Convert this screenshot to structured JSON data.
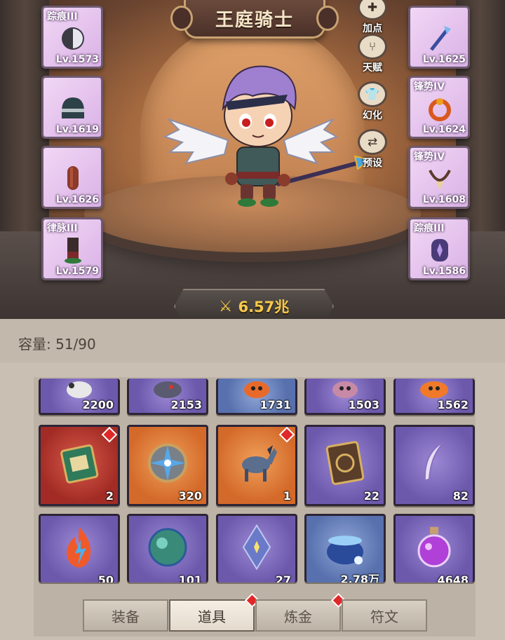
{
  "title": "王庭骑士",
  "left_slots": [
    {
      "name": "踪痕III",
      "level": "Lv.1573",
      "icon": "gloves-icon"
    },
    {
      "name": "",
      "level": "Lv.1619",
      "icon": "helmet-icon"
    },
    {
      "name": "",
      "level": "Lv.1626",
      "icon": "boots-icon"
    },
    {
      "name": "律脉III",
      "level": "Lv.1579",
      "icon": "leg-armor-icon"
    }
  ],
  "right_slots": [
    {
      "name": "",
      "level": "Lv.1625",
      "icon": "staff-icon"
    },
    {
      "name": "锋势IV",
      "level": "Lv.1624",
      "icon": "ring-icon"
    },
    {
      "name": "锋势IV",
      "level": "Lv.1608",
      "icon": "amulet-icon"
    },
    {
      "name": "踪痕III",
      "level": "Lv.1586",
      "icon": "charm-icon"
    }
  ],
  "side_menu": [
    {
      "label": "加点",
      "icon": "add-points-icon"
    },
    {
      "label": "天赋",
      "icon": "talent-tree-icon"
    },
    {
      "label": "幻化",
      "icon": "costume-icon"
    },
    {
      "label": "预设",
      "icon": "preset-icon"
    }
  ],
  "power": "6.57兆",
  "capacity_label": "容量: 51/90",
  "items_row1": [
    {
      "qty": "2200",
      "color": "purple",
      "icon": "pet-bird-icon"
    },
    {
      "qty": "2153",
      "color": "purple",
      "icon": "pet-beast-icon"
    },
    {
      "qty": "1731",
      "color": "blue",
      "icon": "pet-fox-icon"
    },
    {
      "qty": "1503",
      "color": "purple",
      "icon": "pet-pig-icon"
    },
    {
      "qty": "1562",
      "color": "purple",
      "icon": "pet-fox-orange-icon"
    }
  ],
  "items_row2": [
    {
      "qty": "2",
      "color": "red",
      "icon": "book-green-icon",
      "badge": true
    },
    {
      "qty": "320",
      "color": "orange",
      "icon": "compass-medal-icon",
      "badge": false
    },
    {
      "qty": "1",
      "color": "orange",
      "icon": "horse-icon",
      "badge": true
    },
    {
      "qty": "22",
      "color": "purple",
      "icon": "book-gold-icon",
      "badge": false
    },
    {
      "qty": "82",
      "color": "purple",
      "icon": "feather-quill-icon",
      "badge": false
    }
  ],
  "items_row3": [
    {
      "qty": "50",
      "color": "purple",
      "icon": "fire-lightning-icon"
    },
    {
      "qty": "101",
      "color": "purple",
      "icon": "green-orb-icon"
    },
    {
      "qty": "27",
      "color": "purple",
      "icon": "crystal-icon"
    },
    {
      "qty": "2.78万",
      "color": "blue",
      "icon": "cauldron-icon"
    },
    {
      "qty": "4648",
      "color": "purple",
      "icon": "potion-icon"
    }
  ],
  "tabs": [
    {
      "label": "装备",
      "active": false,
      "badge": false
    },
    {
      "label": "道具",
      "active": true,
      "badge": true
    },
    {
      "label": "炼金",
      "active": false,
      "badge": true
    },
    {
      "label": "符文",
      "active": false,
      "badge": false
    }
  ]
}
